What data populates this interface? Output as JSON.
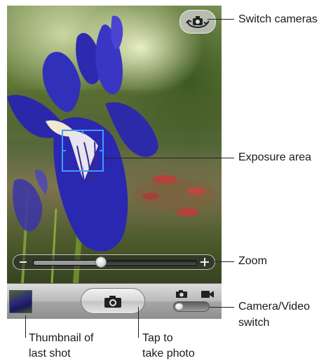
{
  "callouts": {
    "switch_cameras": "Switch cameras",
    "exposure_area": "Exposure area",
    "zoom": "Zoom",
    "camera_video_line1": "Camera/Video",
    "camera_video_line2": "switch",
    "thumbnail_line1": "Thumbnail of",
    "thumbnail_line2": "last shot",
    "tap_line1": "Tap to",
    "tap_line2": "take photo"
  },
  "icons": {
    "switch_cameras": "camera-rotate-icon",
    "shutter": "camera-icon",
    "mode_photo": "camera-icon",
    "mode_video": "video-camera-icon"
  },
  "zoom": {
    "level": 0.42
  },
  "mode_switch": {
    "selected": "camera"
  },
  "colors": {
    "exposure_box": "#3f9cff",
    "callout_text": "#1a1a1a"
  }
}
